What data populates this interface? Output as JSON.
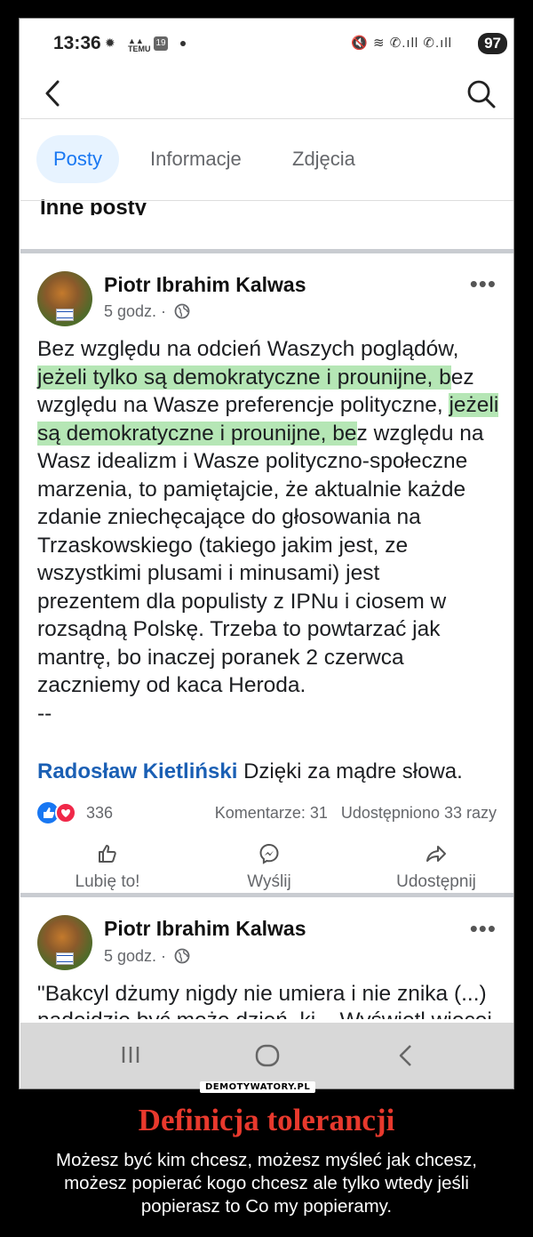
{
  "status_bar": {
    "time": "13:36",
    "badge": "19",
    "battery": "97"
  },
  "tabs": [
    {
      "label": "Posty",
      "active": true
    },
    {
      "label": "Informacje",
      "active": false
    },
    {
      "label": "Zdjęcia",
      "active": false
    }
  ],
  "section_title": "Inne posty",
  "post1": {
    "author": "Piotr Ibrahim Kalwas",
    "time": "5 godz. ·",
    "lines": [
      "Bez względu na odcień Waszych poglądów,",
      "jeżeli tylko są demokratyczne i prounijne, bez",
      "względu na Wasze preferencje polityczne, jeżeli",
      "są demokratyczne i prounijne, bez względu na",
      "Wasz idealizm i Wasze polityczno-społeczne",
      "marzenia, to pamiętajcie, że aktualnie każde",
      "zdanie zniechęcające do głosowania na",
      "Trzaskowskiego (takiego jakim jest, ze",
      "wszystkimi plusami i minusami) jest",
      "prezentem dla populisty z IPNu i ciosem w",
      "rozsądną Polskę. Trzeba to powtarzać jak",
      "mantrę, bo inaczej poranek 2 czerwca",
      "zaczniemy od kaca Heroda.",
      "--"
    ],
    "comment_author": "Radosław Kietliński",
    "comment_text": " Dzięki za mądre słowa.",
    "reaction_count": "336",
    "comments": "Komentarze: 31",
    "shares": "Udostępniono 33 razy",
    "actions": {
      "like": "Lubię to!",
      "send": "Wyślij",
      "share": "Udostępnij"
    }
  },
  "post2": {
    "author": "Piotr Ibrahim Kalwas",
    "time": "5 godz. ·",
    "text": "\"Bakcyl dżumy nigdy nie umiera i nie znika (...)",
    "text_cut": "nadejdzie być może dzień, ki... Wyświetl więcej"
  },
  "footer": {
    "logo": "DEMOTYWATORY.PL",
    "title": "Definicja tolerancji",
    "subtitle": "Możesz być kim chcesz, możesz myśleć jak chcesz, możesz popierać kogo chcesz ale tylko wtedy jeśli popierasz to Co my popieramy."
  },
  "colors": {
    "accent": "#1877f2",
    "title_red": "#e8392d",
    "highlight": "#78d278"
  }
}
